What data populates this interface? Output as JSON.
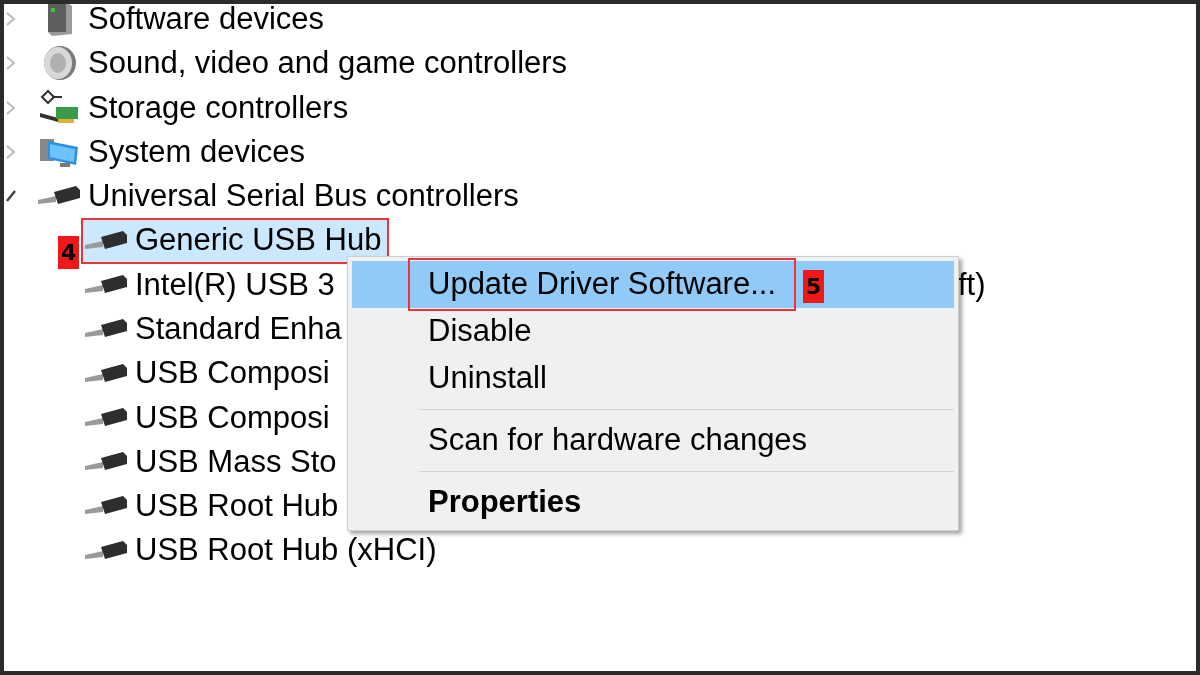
{
  "tree": [
    {
      "label": "Software devices",
      "kind": "software",
      "expanded": false
    },
    {
      "label": "Sound, video and game controllers",
      "kind": "sound",
      "expanded": false
    },
    {
      "label": "Storage controllers",
      "kind": "storage",
      "expanded": false
    },
    {
      "label": "System devices",
      "kind": "system",
      "expanded": false
    },
    {
      "label": "Universal Serial Bus controllers",
      "kind": "usb",
      "expanded": true,
      "children": [
        {
          "label": "Generic USB Hub",
          "kind": "usb",
          "selected": true,
          "callout": "4"
        },
        {
          "label": "Intel(R) USB 3",
          "tail": "ft)",
          "kind": "usb",
          "selected": false
        },
        {
          "label": "Standard Enha",
          "kind": "usb",
          "selected": false
        },
        {
          "label": "USB Composi",
          "kind": "usb",
          "selected": false
        },
        {
          "label": "USB Composi",
          "kind": "usb",
          "selected": false
        },
        {
          "label": "USB Mass Sto",
          "kind": "usb",
          "selected": false
        },
        {
          "label": "USB Root Hub",
          "kind": "usb",
          "selected": false
        },
        {
          "label": "USB Root Hub (xHCI)",
          "kind": "usb",
          "selected": false
        }
      ]
    }
  ],
  "context_menu": {
    "items": [
      {
        "kind": "item",
        "label": "Update Driver Software...",
        "selected": true,
        "default": false,
        "callout": "5"
      },
      {
        "kind": "item",
        "label": "Disable",
        "selected": false,
        "default": false
      },
      {
        "kind": "item",
        "label": "Uninstall",
        "selected": false,
        "default": false
      },
      {
        "kind": "separator"
      },
      {
        "kind": "item",
        "label": "Scan for hardware changes",
        "selected": false,
        "default": false
      },
      {
        "kind": "separator"
      },
      {
        "kind": "item",
        "label": "Properties",
        "selected": false,
        "default": true
      }
    ]
  }
}
